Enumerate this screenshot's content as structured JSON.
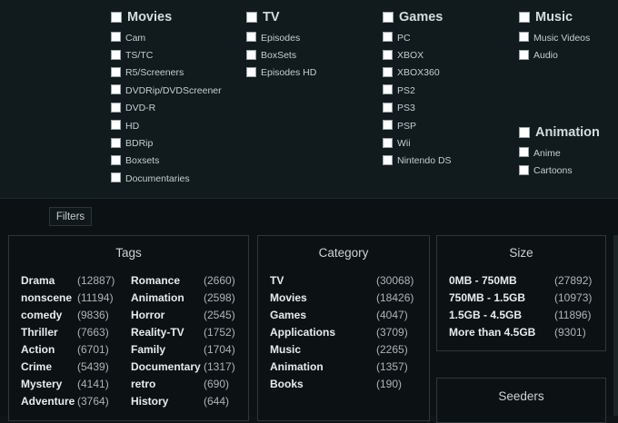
{
  "categories": {
    "movies": {
      "title": "Movies",
      "items": [
        "Cam",
        "TS/TC",
        "R5/Screeners",
        "DVDRip/DVDScreener",
        "DVD-R",
        "HD",
        "BDRip",
        "Boxsets",
        "Documentaries"
      ]
    },
    "tv": {
      "title": "TV",
      "items": [
        "Episodes",
        "BoxSets",
        "Episodes HD"
      ]
    },
    "games": {
      "title": "Games",
      "items": [
        "PC",
        "XBOX",
        "XBOX360",
        "PS2",
        "PS3",
        "PSP",
        "Wii",
        "Nintendo DS"
      ]
    },
    "music": {
      "title": "Music",
      "items": [
        "Music Videos",
        "Audio"
      ]
    },
    "animation": {
      "title": "Animation",
      "items": [
        "Anime",
        "Cartoons"
      ]
    }
  },
  "filters_label": "Filters",
  "tags": {
    "title": "Tags",
    "left": [
      {
        "name": "Drama",
        "count": "(12887)"
      },
      {
        "name": "nonscene",
        "count": "(11194)"
      },
      {
        "name": "comedy",
        "count": "(9836)"
      },
      {
        "name": "Thriller",
        "count": "(7663)"
      },
      {
        "name": "Action",
        "count": "(6701)"
      },
      {
        "name": "Crime",
        "count": "(5439)"
      },
      {
        "name": "Mystery",
        "count": "(4141)"
      },
      {
        "name": "Adventure",
        "count": "(3764)"
      }
    ],
    "right": [
      {
        "name": "Romance",
        "count": "(2660)"
      },
      {
        "name": "Animation",
        "count": "(2598)"
      },
      {
        "name": "Horror",
        "count": "(2545)"
      },
      {
        "name": "Reality-TV",
        "count": "(1752)"
      },
      {
        "name": "Family",
        "count": "(1704)"
      },
      {
        "name": "Documentary",
        "count": "(1317)"
      },
      {
        "name": "retro",
        "count": "(690)"
      },
      {
        "name": "History",
        "count": "(644)"
      }
    ]
  },
  "category": {
    "title": "Category",
    "rows": [
      {
        "name": "TV",
        "count": "(30068)"
      },
      {
        "name": "Movies",
        "count": "(18426)"
      },
      {
        "name": "Games",
        "count": "(4047)"
      },
      {
        "name": "Applications",
        "count": "(3709)"
      },
      {
        "name": "Music",
        "count": "(2265)"
      },
      {
        "name": "Animation",
        "count": "(1357)"
      },
      {
        "name": "Books",
        "count": "(190)"
      }
    ]
  },
  "size": {
    "title": "Size",
    "rows": [
      {
        "name": "0MB - 750MB",
        "count": "(27892)"
      },
      {
        "name": "750MB - 1.5GB",
        "count": "(10973)"
      },
      {
        "name": "1.5GB - 4.5GB",
        "count": "(11896)"
      },
      {
        "name": "More than 4.5GB",
        "count": "(9301)"
      }
    ]
  },
  "seeders": {
    "title": "Seeders"
  }
}
